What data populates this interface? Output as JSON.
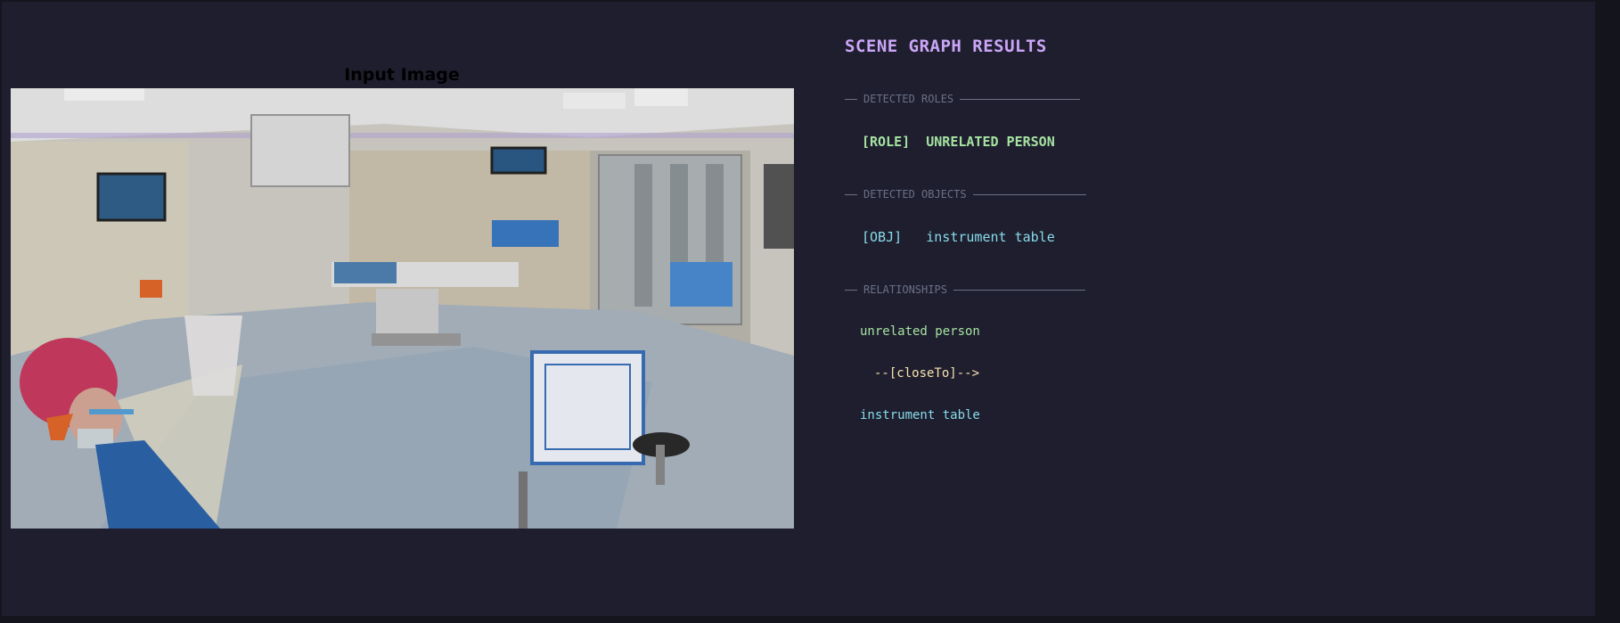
{
  "image_panel": {
    "title": "Input Image"
  },
  "results": {
    "heading": "SCENE GRAPH RESULTS",
    "sections": {
      "roles": "DETECTED ROLES",
      "objects": "DETECTED OBJECTS",
      "relationships": "RELATIONSHIPS"
    },
    "roles": [
      {
        "tag": "[ROLE]",
        "name": "UNRELATED PERSON"
      }
    ],
    "objects": [
      {
        "tag": "[OBJ]",
        "name": "instrument table"
      }
    ],
    "relationships": [
      {
        "subject": "unrelated person",
        "predicate": "--[closeTo]-->",
        "object": "instrument table"
      }
    ]
  },
  "colors": {
    "background": "#1e1e2e",
    "heading": "#cba6f7",
    "section": "#6c7086",
    "role": "#a6e3a1",
    "object": "#89dceb",
    "predicate": "#f9e2af"
  }
}
